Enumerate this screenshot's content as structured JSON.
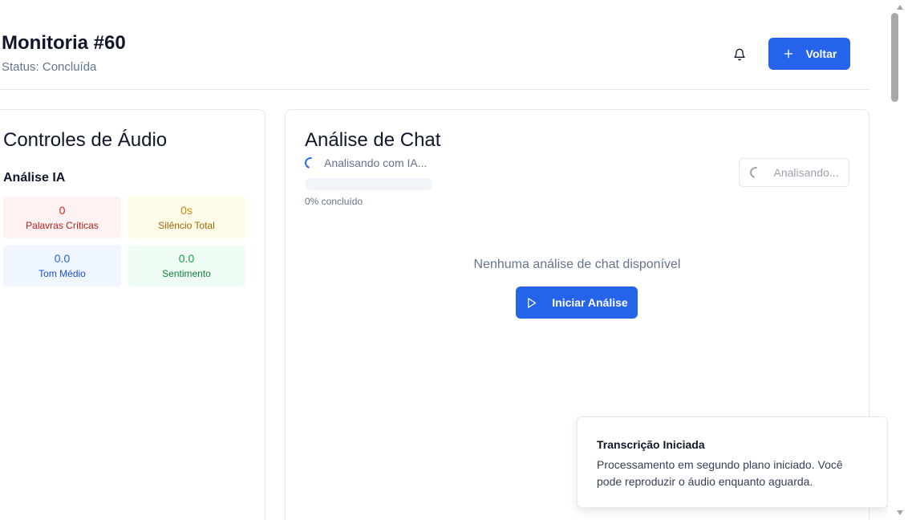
{
  "header": {
    "title": "Monitoria #60",
    "status": "Status: Concluída",
    "bell_icon": "bell-icon",
    "back_button_label": "Voltar",
    "back_button_icon": "plus-icon"
  },
  "audio_controls": {
    "title": "Controles de Áudio",
    "subtitle": "Análise IA",
    "stats": [
      {
        "value": "0",
        "label": "Palavras Críticas",
        "color": "#dc2626"
      },
      {
        "value": "0s",
        "label": "Silêncio Total",
        "color": "#ca8a04"
      },
      {
        "value": "0.0",
        "label": "Tom Médio",
        "color": "#2563eb"
      },
      {
        "value": "0.0",
        "label": "Sentimento",
        "color": "#16a34a"
      }
    ]
  },
  "chat_analysis": {
    "title": "Análise de Chat",
    "analyzing_text": "Analisando com IA...",
    "progress": 0,
    "progress_label": "0% concluído",
    "analyzing_button_label": "Analisando...",
    "empty_message": "Nenhuma análise de chat disponível",
    "start_button_label": "Iniciar Análise",
    "start_button_icon": "play-icon"
  },
  "toast": {
    "title": "Transcrição Iniciada",
    "body": "Processamento em segundo plano iniciado. Você pode reproduzir o áudio enquanto aguarda."
  },
  "colors": {
    "primary": "#2563eb",
    "muted_text": "#64748b",
    "border": "#e5e7eb"
  }
}
